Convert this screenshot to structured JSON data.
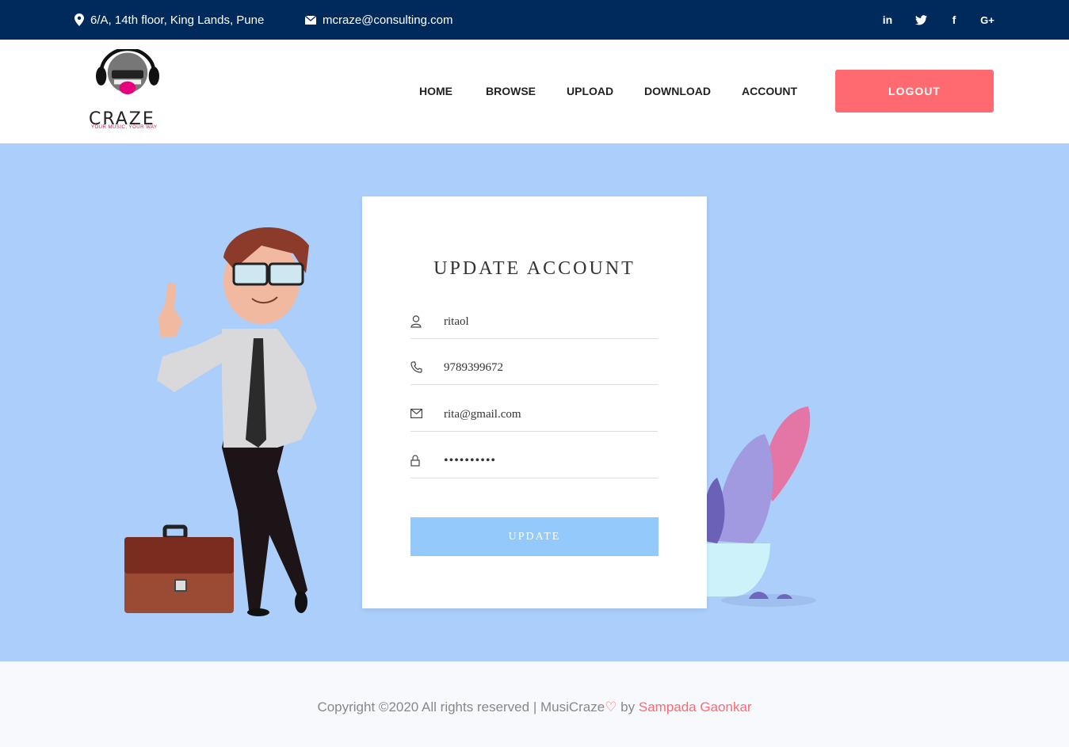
{
  "topbar": {
    "address": "6/A, 14th floor, King Lands, Pune",
    "email": "mcraze@consulting.com",
    "social": [
      "linkedin-icon",
      "twitter-icon",
      "facebook-icon",
      "google-plus-icon"
    ]
  },
  "brand": {
    "name": "CRAZE",
    "tagline": "YOUR MUSIC, YOUR WAY"
  },
  "nav": {
    "home": "HOME",
    "browse": "BROWSE",
    "upload": "UPLOAD",
    "download": "DOWNLOAD",
    "account": "ACCOUNT",
    "logout": "LOGOUT"
  },
  "form": {
    "title": "UPDATE ACCOUNT",
    "username": "ritaol",
    "phone": "9789399672",
    "email": "rita@gmail.com",
    "password": "••••••••••",
    "submit": "UPDATE"
  },
  "footer": {
    "copyright": "Copyright ©2020 All rights reserved | MusiCraze",
    "by": " by ",
    "author": "Sampada Gaonkar"
  },
  "colors": {
    "topbar": "#002a5c",
    "accent": "#ff6970",
    "hero_bg": "#accefa",
    "button": "#93c9fb"
  }
}
